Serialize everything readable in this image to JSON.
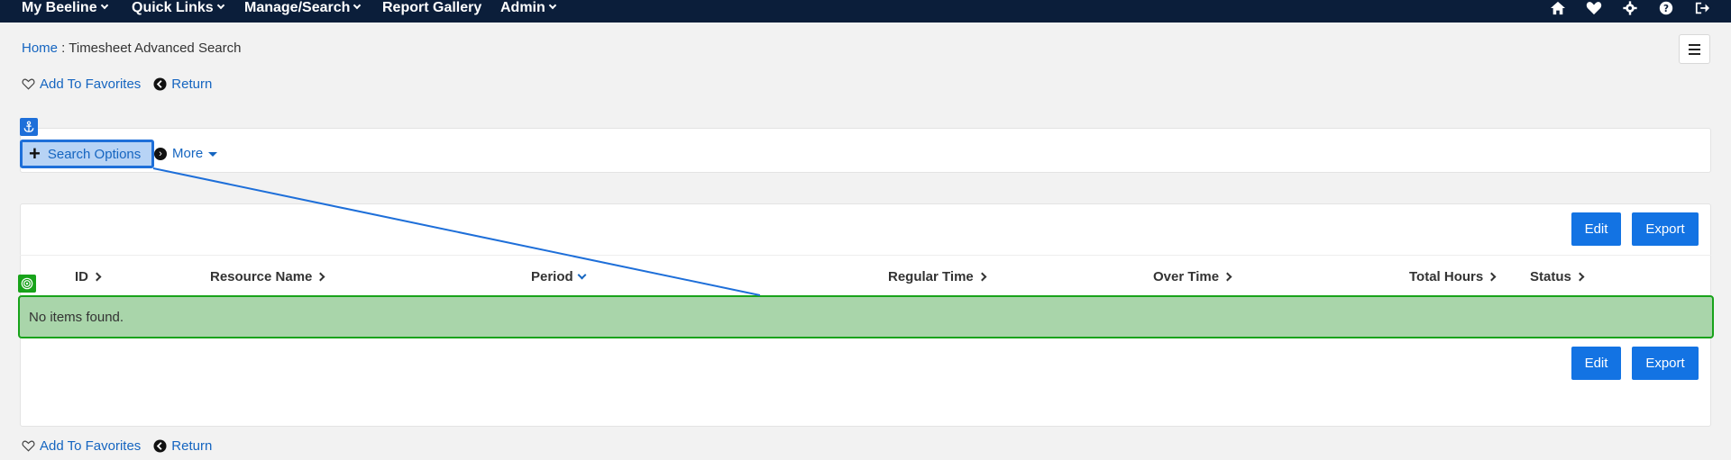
{
  "nav": {
    "items": [
      "My Beeline",
      "Quick Links",
      "Manage/Search",
      "Report Gallery",
      "Admin"
    ],
    "icons": [
      "home-icon",
      "heart-icon",
      "gear-icon",
      "help-icon",
      "sign-out-icon"
    ]
  },
  "breadcrumb": {
    "home": "Home",
    "separator": " : ",
    "current": "Timesheet Advanced Search"
  },
  "actions": {
    "favorites": "Add To Favorites",
    "return": "Return"
  },
  "search": {
    "options_label": "Search Options",
    "more_label": "More"
  },
  "toolbar": {
    "edit_label": "Edit",
    "export_label": "Export"
  },
  "table": {
    "columns": [
      "ID",
      "Resource Name",
      "Period",
      "Regular Time",
      "Over Time",
      "Total Hours",
      "Status"
    ],
    "sorted_column": "Period",
    "empty_text": "No items found."
  },
  "colors": {
    "nav_bg": "#0b1e3a",
    "accent": "#1373e3",
    "link": "#1565c0",
    "success_highlight": "#a9d5aa",
    "success_border": "#18a31a"
  }
}
